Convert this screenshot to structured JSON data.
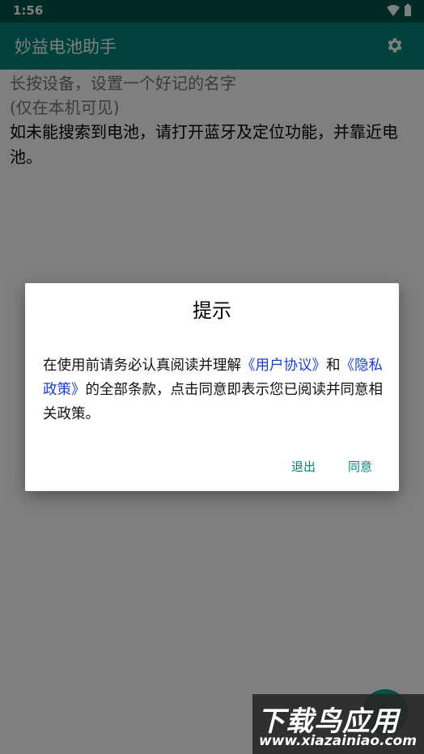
{
  "status_bar": {
    "time": "1:56"
  },
  "app_bar": {
    "title": "妙益电池助手"
  },
  "content": {
    "hint_line1": "长按设备，设置一个好记的名字",
    "hint_line2": "(仅在本机可见)",
    "instruction": "如未能搜索到电池，请打开蓝牙及定位功能，并靠近电池。"
  },
  "dialog": {
    "title": "提示",
    "body_prefix": "在使用前请务必认真阅读并理解",
    "user_agreement_link": "《用户协议》",
    "body_and": "和",
    "privacy_policy_link": "《隐私政策》",
    "body_suffix": "的全部条款，点击同意即表示您已阅读并同意相关政策。",
    "exit_label": "退出",
    "agree_label": "同意"
  },
  "watermark": {
    "text": "下载鸟应用",
    "url": "www.xiazainiao.com"
  },
  "colors": {
    "status_bar": "#00574b",
    "app_bar": "#008577",
    "link": "#1a3fd1",
    "dialog_button": "#008577"
  }
}
